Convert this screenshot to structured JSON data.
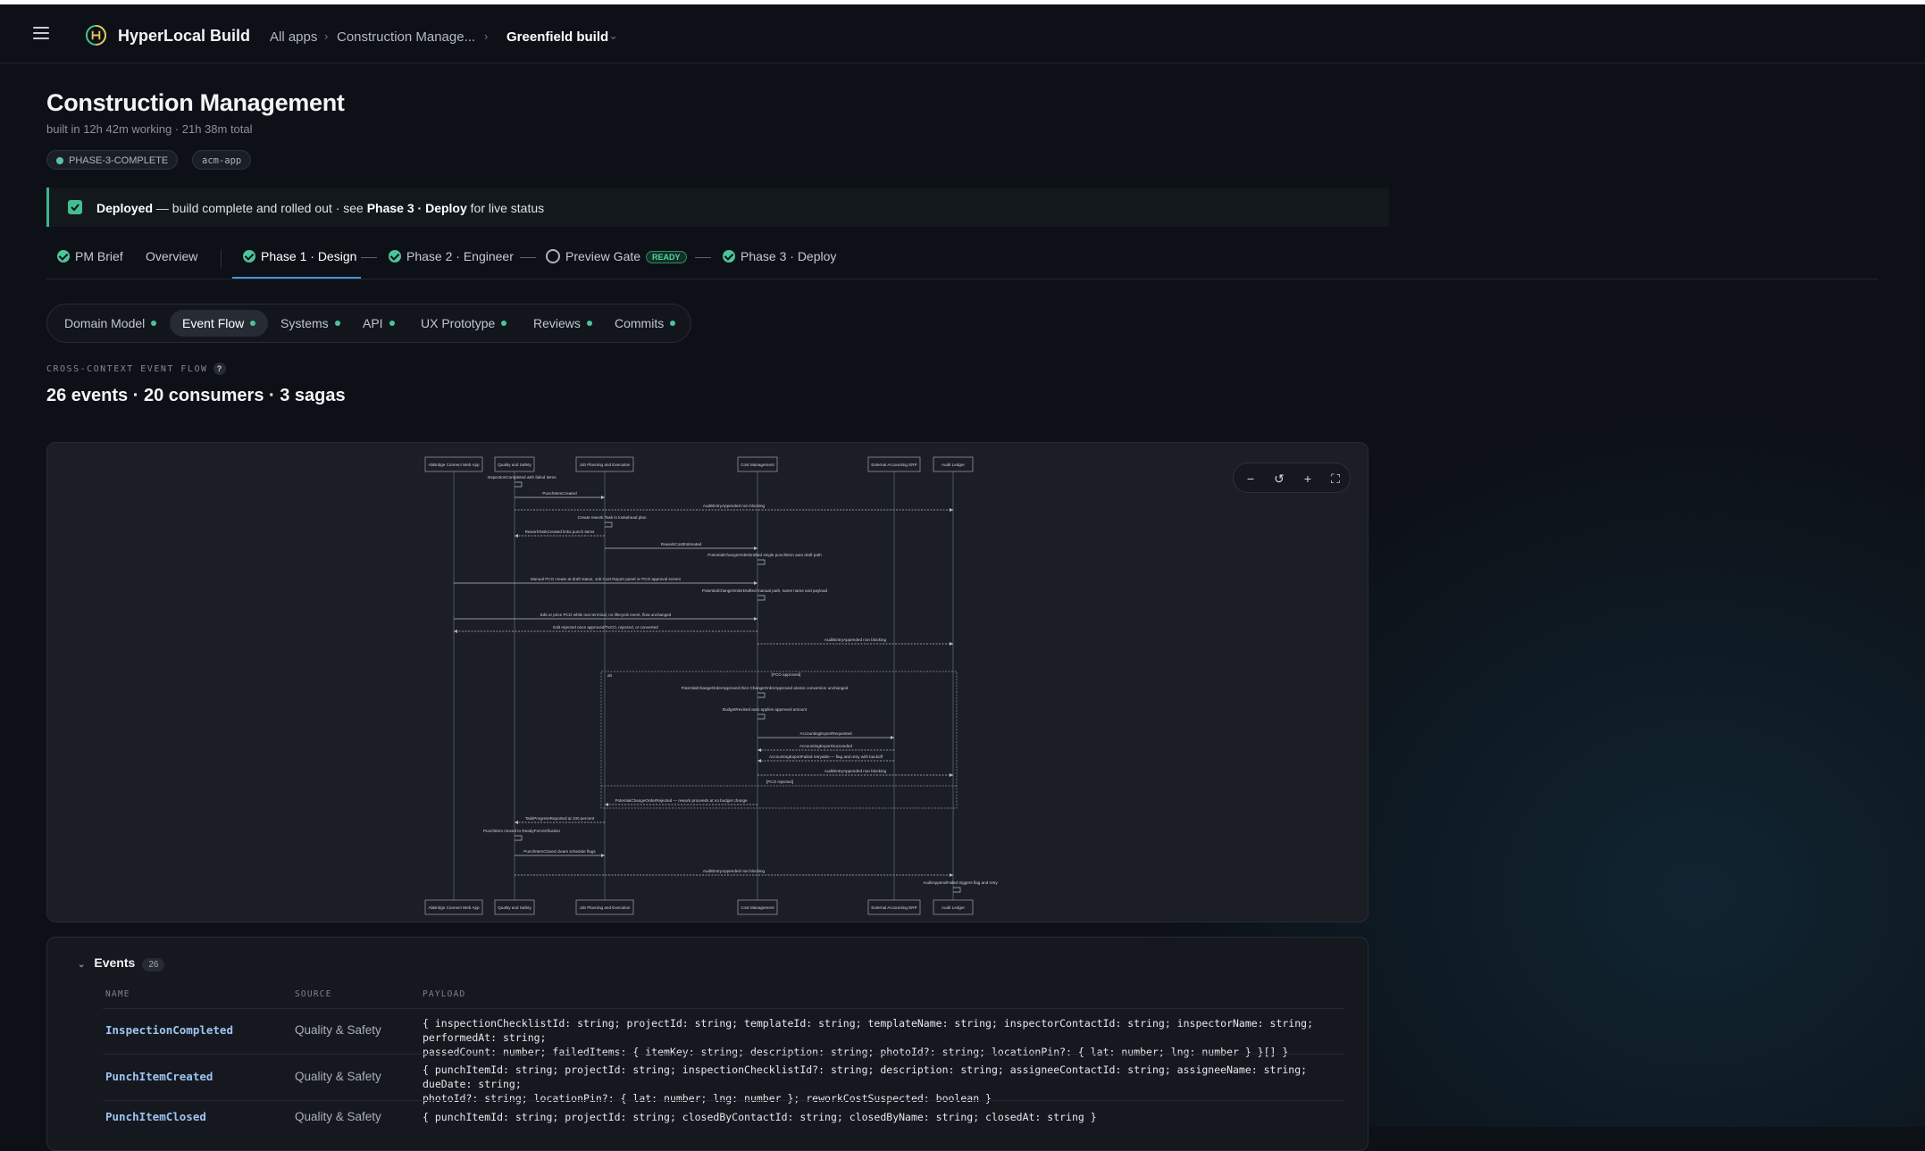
{
  "topbar": {
    "brand": "HyperLocal Build",
    "crumbs": [
      "All apps",
      "Construction Manage...",
      "Greenfield build"
    ],
    "crumb_sep": "›",
    "dropdown_glyph": "⌄"
  },
  "page": {
    "title": "Construction Management",
    "subtitle": "built in 12h 42m working · 21h 38m total",
    "badges": [
      "PHASE-3-COMPLETE",
      "acm-app"
    ]
  },
  "banner": {
    "strong": "Deployed",
    "text": " — build complete and rolled out · see ",
    "link": "Phase 3 · Deploy",
    "tail": " for live status"
  },
  "phases": {
    "items": [
      "PM Brief",
      "Overview",
      "Phase 1 · Design",
      "Phase 2 · Engineer",
      "Preview Gate",
      "Phase 3 · Deploy"
    ],
    "ready_badge": "READY",
    "active": "Phase 1 · Design"
  },
  "subtabs": {
    "items": [
      "Domain Model",
      "Event Flow",
      "Systems",
      "API",
      "UX Prototype",
      "Reviews",
      "Commits"
    ],
    "active": "Event Flow"
  },
  "section": {
    "label": "CROSS-CONTEXT EVENT FLOW",
    "help": "?",
    "stats": "26 events · 20 consumers · 3 sagas"
  },
  "diagram": {
    "actors": [
      "AbBridge Connect Web App",
      "Quality and Safety",
      "Job Planning and Execution",
      "Cost Management",
      "External Accounting ERP",
      "Audit Ledger"
    ],
    "messages": [
      "InspectionCompleted with failed items",
      "PunchItemCreated",
      "AuditEntryAppended non blocking",
      "Create rework Task in lookahead plan",
      "ReworkTaskCreated links punch items",
      "ReworkCostEstimated",
      "PotentialChangeOrderDrafted single punchitem auto draft path",
      "Manual PCO create at draft status, Job Cost Report panel or PCO approval screen",
      "PotentialChangeOrderDrafted manual path, same name and payload",
      "Edit or price PCO while non terminal, no lifecycle event, flow unchanged",
      "Edit rejected once approved/TxCO, rejected, or converted",
      "AuditEntryAppended non blocking",
      "PotentialChangeOrderApproved then ChangeOrderApproved atomic conversion unchanged",
      "BudgetRevised auto applies approved amount",
      "AccountingExportRequested",
      "AccountingExportSucceeded",
      "AccountingExportFailed retryable — flag and retry with backoff",
      "AuditEntryAppended non blocking",
      "PotentialChangeOrderRejected — rework proceeds at no budget change",
      "TaskProgressReported at 100 percent",
      "PunchItem moved to ReadyForVerification",
      "PunchItemClosed clears schedule flags",
      "AuditEntryAppended non blocking",
      "AuditAppendFailed triggers flag and retry"
    ],
    "guards": [
      "[PCO approved]",
      "[PCO rejected]"
    ],
    "alt_label": "alt",
    "zoom": {
      "minus": "−",
      "reset": "↺",
      "plus": "+",
      "fit": "⛶"
    }
  },
  "events": {
    "title": "Events",
    "count": "26",
    "columns": [
      "NAME",
      "SOURCE",
      "PAYLOAD"
    ],
    "rows": [
      {
        "name": "InspectionCompleted",
        "source": "Quality & Safety",
        "payload1": "{ inspectionChecklistId: string; projectId: string; templateId: string; templateName: string; inspectorContactId: string; inspectorName: string; performedAt: string;",
        "payload2": "passedCount: number; failedItems: { itemKey: string; description: string; photoId?: string; locationPin?: { lat: number; lng: number } }[] }"
      },
      {
        "name": "PunchItemCreated",
        "source": "Quality & Safety",
        "payload1": "{ punchItemId: string; projectId: string; inspectionChecklistId?: string; description: string; assigneeContactId: string; assigneeName: string; dueDate: string;",
        "payload2": "photoId?: string; locationPin?: { lat: number; lng: number }; reworkCostSuspected: boolean }"
      },
      {
        "name": "PunchItemClosed",
        "source": "Quality & Safety",
        "payload1": "{ punchItemId: string; projectId: string; closedByContactId: string; closedByName: string; closedAt: string }",
        "payload2": ""
      }
    ]
  },
  "colors": {
    "background": "#0d1016",
    "accent_green": "#4cc596",
    "accent_blue": "#4f8fd8",
    "event_name": "#9ec3f3"
  }
}
